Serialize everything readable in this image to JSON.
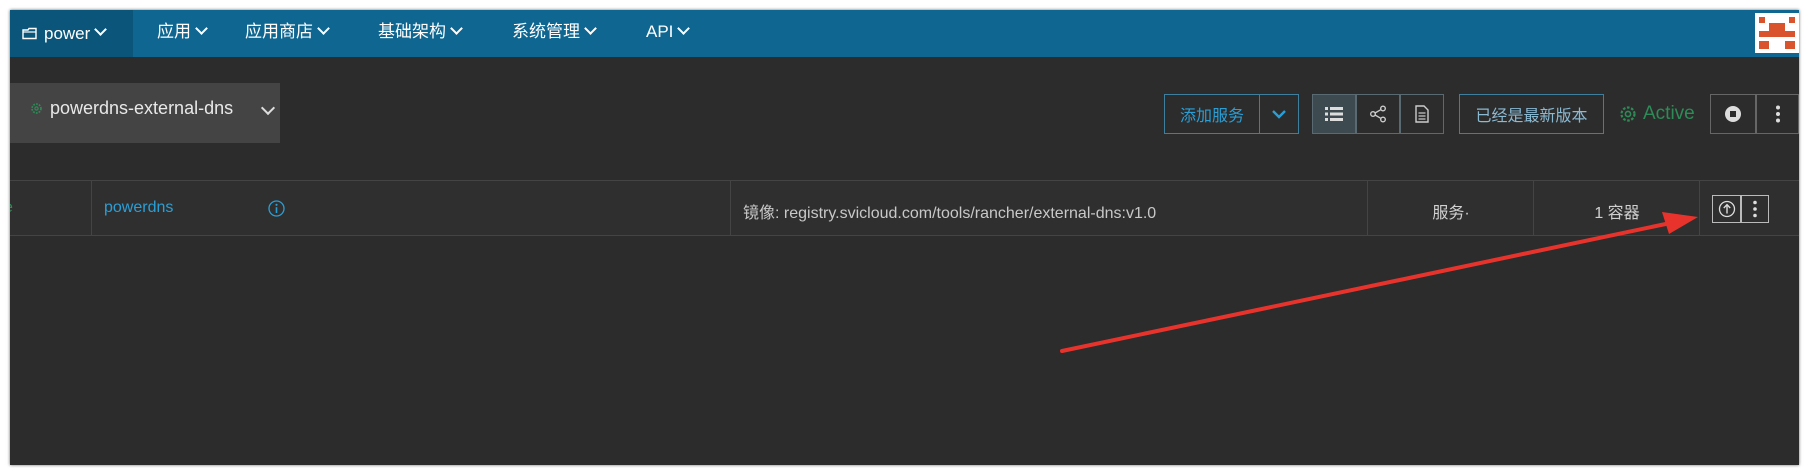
{
  "header": {
    "environment": "power",
    "nav": [
      {
        "label": "应用"
      },
      {
        "label": "应用商店"
      },
      {
        "label": "基础架构"
      },
      {
        "label": "系统管理"
      },
      {
        "label": "API"
      }
    ],
    "avatar_icon": "user-avatar-icon"
  },
  "stack": {
    "name": "powerdns-external-dns",
    "add_service_label": "添加服务",
    "latest_version_label": "已经是最新版本",
    "state": "Active",
    "state_color": "#2e8b57"
  },
  "services": [
    {
      "name": "powerdns",
      "image": "镜像: registry.svicloud.com/tools/rancher/external-dns:v1.0",
      "kind": "服务·",
      "scale": "1 容器"
    }
  ],
  "colors": {
    "nav_bg": "#0e6691",
    "env_bg": "#0b557a",
    "link": "#2a9fd6",
    "annotation": "#e8332c"
  }
}
